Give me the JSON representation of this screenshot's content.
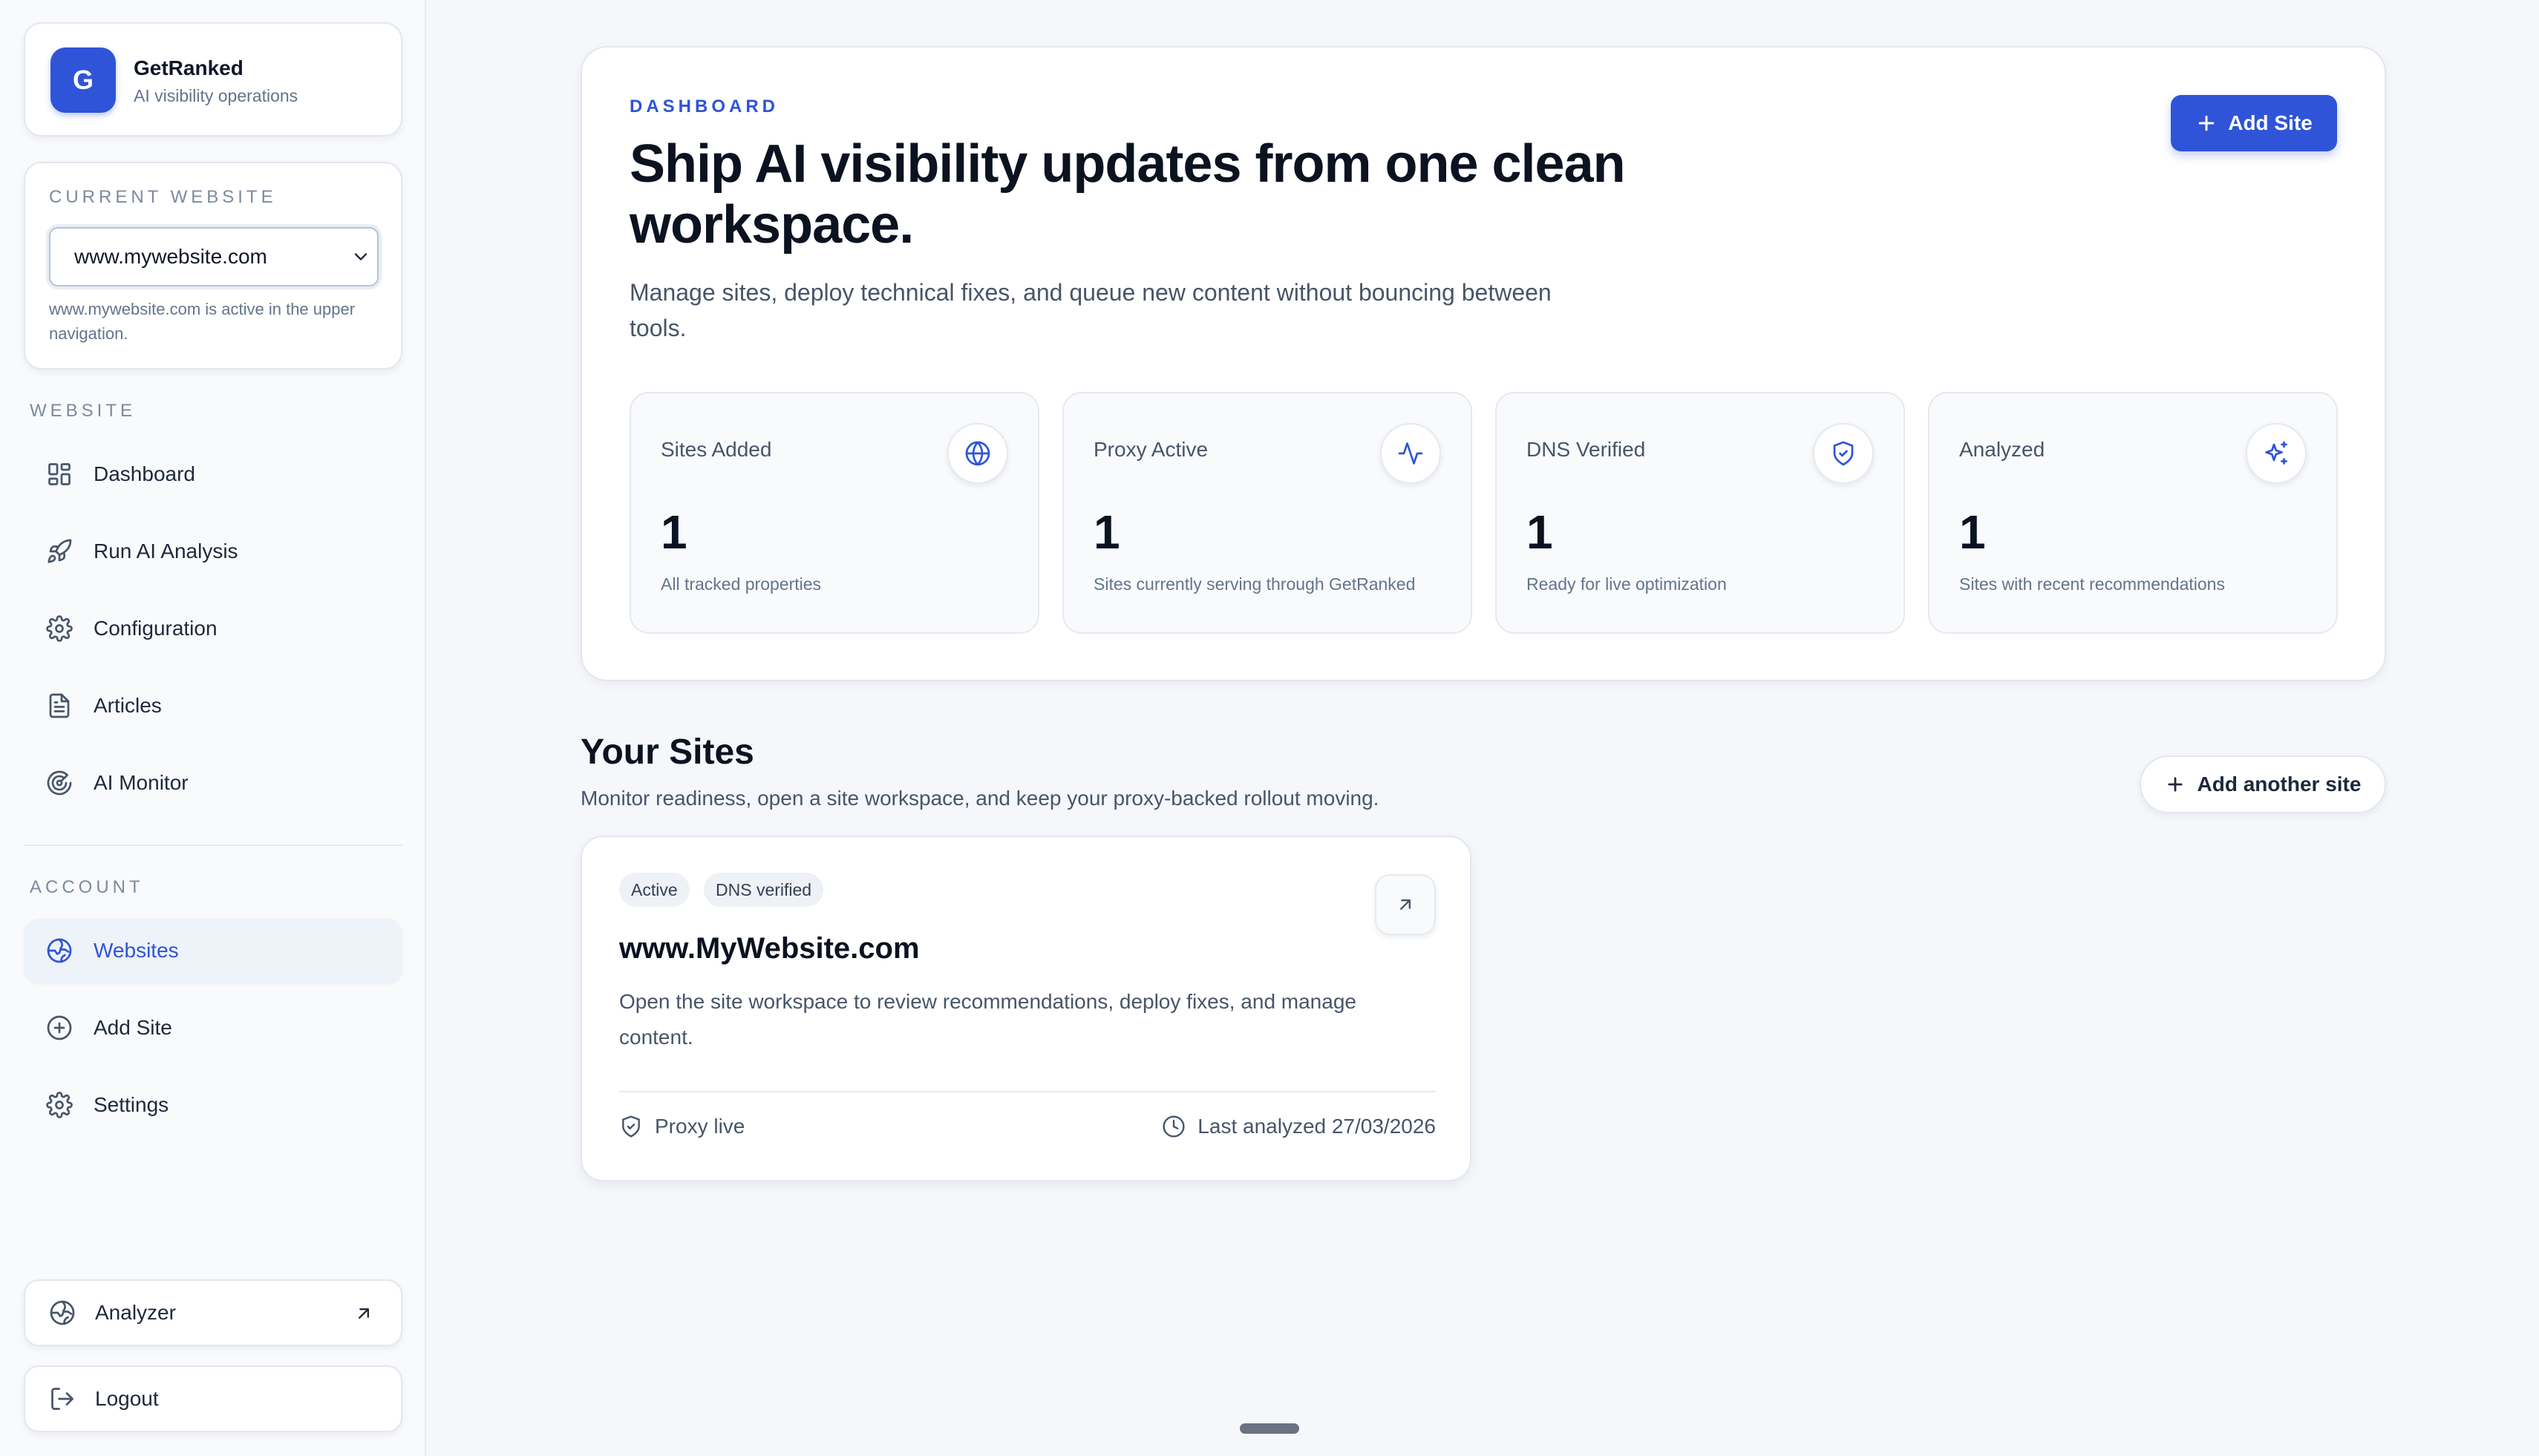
{
  "brand": {
    "initial": "G",
    "name": "GetRanked",
    "tagline": "AI visibility operations"
  },
  "current_website": {
    "label": "CURRENT WEBSITE",
    "selected": "www.mywebsite.com",
    "note": "www.mywebsite.com is active in the upper navigation."
  },
  "sidebar": {
    "website_label": "WEBSITE",
    "website_items": [
      {
        "label": "Dashboard",
        "icon": "dashboard-icon"
      },
      {
        "label": "Run AI Analysis",
        "icon": "rocket-icon"
      },
      {
        "label": "Configuration",
        "icon": "gear-icon"
      },
      {
        "label": "Articles",
        "icon": "document-icon"
      },
      {
        "label": "AI Monitor",
        "icon": "radar-icon"
      }
    ],
    "account_label": "ACCOUNT",
    "account_items": [
      {
        "label": "Websites",
        "icon": "globe-icon",
        "active": true
      },
      {
        "label": "Add Site",
        "icon": "plus-circle-icon"
      },
      {
        "label": "Settings",
        "icon": "gear-icon"
      }
    ],
    "analyzer_label": "Analyzer",
    "logout_label": "Logout"
  },
  "hero": {
    "eyebrow": "DASHBOARD",
    "title": "Ship AI visibility updates from one clean workspace.",
    "description": "Manage sites, deploy technical fixes, and queue new content without bouncing between tools.",
    "add_site_label": "Add Site"
  },
  "stats": [
    {
      "title": "Sites Added",
      "value": "1",
      "sub": "All tracked properties",
      "icon": "globe-icon"
    },
    {
      "title": "Proxy Active",
      "value": "1",
      "sub": "Sites currently serving through GetRanked",
      "icon": "activity-icon"
    },
    {
      "title": "DNS Verified",
      "value": "1",
      "sub": "Ready for live optimization",
      "icon": "shield-check-icon"
    },
    {
      "title": "Analyzed",
      "value": "1",
      "sub": "Sites with recent recommendations",
      "icon": "sparkles-icon"
    }
  ],
  "sites": {
    "title": "Your Sites",
    "description": "Monitor readiness, open a site workspace, and keep your proxy-backed rollout moving.",
    "add_another_label": "Add another site",
    "cards": [
      {
        "badges": [
          "Active",
          "DNS verified"
        ],
        "name": "www.MyWebsite.com",
        "description": "Open the site workspace to review recommendations, deploy fixes, and manage content.",
        "proxy_status": "Proxy live",
        "last_analyzed": "Last analyzed 27/03/2026"
      }
    ]
  },
  "colors": {
    "accent": "#2f54d8",
    "background": "#f5f7fb",
    "text": "#0f172a",
    "muted": "#64748b"
  }
}
